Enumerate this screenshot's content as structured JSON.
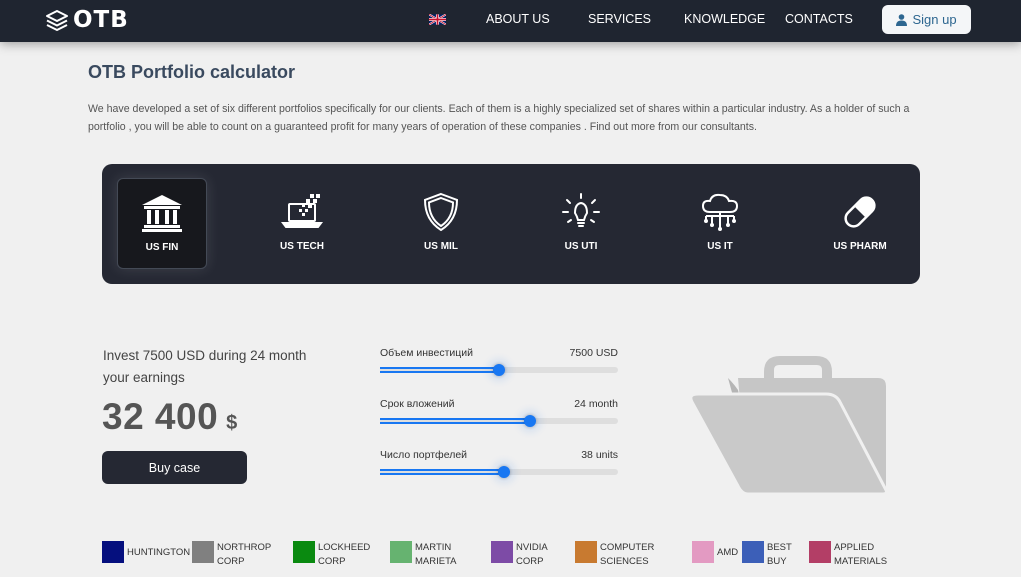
{
  "nav": {
    "logo_text": "OTB",
    "items": [
      "ABOUT US",
      "SERVICES",
      "KNOWLEDGE",
      "CONTACTS"
    ],
    "signup_label": "Sign up"
  },
  "page": {
    "title": "OTB Portfolio calculator",
    "intro": "We have developed a set of six different portfolios specifically for our clients. Each of them is a highly specialized set of shares within a particular industry. As a holder of such a portfolio , you will be able to count on a guaranteed profit for many years of operation of these companies . Find out more from our consultants."
  },
  "portfolios": [
    {
      "label": "US FIN",
      "icon": "bank-icon",
      "active": true
    },
    {
      "label": "US TECH",
      "icon": "laptop-icon",
      "active": false
    },
    {
      "label": "US MIL",
      "icon": "shield-icon",
      "active": false
    },
    {
      "label": "US UTI",
      "icon": "lightbulb-icon",
      "active": false
    },
    {
      "label": "US IT",
      "icon": "cloud-network-icon",
      "active": false
    },
    {
      "label": "US PHARM",
      "icon": "pill-icon",
      "active": false
    }
  ],
  "calc": {
    "invest_text": "Invest 7500 USD during 24 month your earnings",
    "earnings": "32 400",
    "currency": "$",
    "buy_label": "Buy case"
  },
  "sliders": [
    {
      "label": "Объем инвестиций",
      "value_text": "7500 USD",
      "fraction": 0.5
    },
    {
      "label": "Срок вложений",
      "value_text": "24 month",
      "fraction": 0.63
    },
    {
      "label": "Число портфелей",
      "value_text": "38 units",
      "fraction": 0.52
    }
  ],
  "legend": [
    {
      "label": "HUNTINGTON",
      "color": "#050f7e"
    },
    {
      "label": "NORTHROP CORP",
      "color": "#808080"
    },
    {
      "label": "LOCKHEED CORP",
      "color": "#0a8a10"
    },
    {
      "label": "MARTIN MARIETA",
      "color": "#66b370"
    },
    {
      "label": "NVIDIA CORP",
      "color": "#7d4ba6"
    },
    {
      "label": "COMPUTER SCIENCES",
      "color": "#c87a30"
    },
    {
      "label": "AMD",
      "color": "#e39ac2"
    },
    {
      "label": "BEST BUY",
      "color": "#3c5fb8"
    },
    {
      "label": "APPLIED MATERIALS",
      "color": "#b33e66"
    }
  ]
}
